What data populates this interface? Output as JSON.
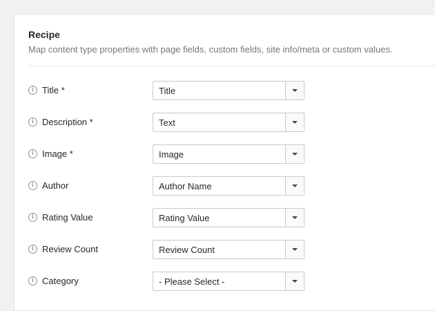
{
  "panel": {
    "title": "Recipe",
    "description": "Map content type properties with page fields, custom fields, site info/meta or custom values."
  },
  "fields": [
    {
      "label": "Title *",
      "value": "Title"
    },
    {
      "label": "Description *",
      "value": "Text"
    },
    {
      "label": "Image *",
      "value": "Image"
    },
    {
      "label": "Author",
      "value": "Author Name"
    },
    {
      "label": "Rating Value",
      "value": "Rating Value"
    },
    {
      "label": "Review Count",
      "value": "Review Count"
    },
    {
      "label": "Category",
      "value": "- Please Select -"
    }
  ],
  "icons": {
    "info": "info-icon",
    "info_glyph": "i",
    "dropdown": "chevron-down-icon"
  },
  "colors": {
    "background": "#f1f1f1",
    "panel": "#ffffff",
    "border": "#c9c9c9",
    "muted_text": "#72777c",
    "text": "#23282d"
  }
}
